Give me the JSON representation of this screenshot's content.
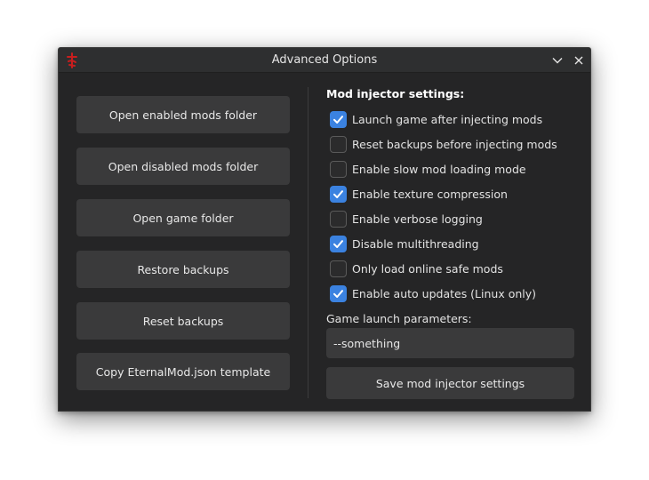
{
  "window": {
    "title": "Advanced Options"
  },
  "left_buttons": [
    {
      "label": "Open enabled mods folder"
    },
    {
      "label": "Open disabled mods folder"
    },
    {
      "label": "Open game folder"
    },
    {
      "label": "Restore backups"
    },
    {
      "label": "Reset backups"
    },
    {
      "label": "Copy EternalMod.json template"
    }
  ],
  "injector": {
    "section_title": "Mod injector settings:",
    "options": [
      {
        "label": "Launch game after injecting mods",
        "checked": true
      },
      {
        "label": "Reset backups before injecting mods",
        "checked": false
      },
      {
        "label": "Enable slow mod loading mode",
        "checked": false
      },
      {
        "label": "Enable texture compression",
        "checked": true
      },
      {
        "label": "Enable verbose logging",
        "checked": false
      },
      {
        "label": "Disable multithreading",
        "checked": true
      },
      {
        "label": "Only load online safe mods",
        "checked": false
      },
      {
        "label": "Enable auto updates (Linux only)",
        "checked": true
      }
    ],
    "launch_params_label": "Game launch parameters:",
    "launch_params_value": "--something",
    "save_label": "Save mod injector settings"
  },
  "colors": {
    "accent": "#3b82e0",
    "window_bg": "#252526",
    "button_bg": "#3a3a3b",
    "app_icon": "#c81e1e"
  }
}
